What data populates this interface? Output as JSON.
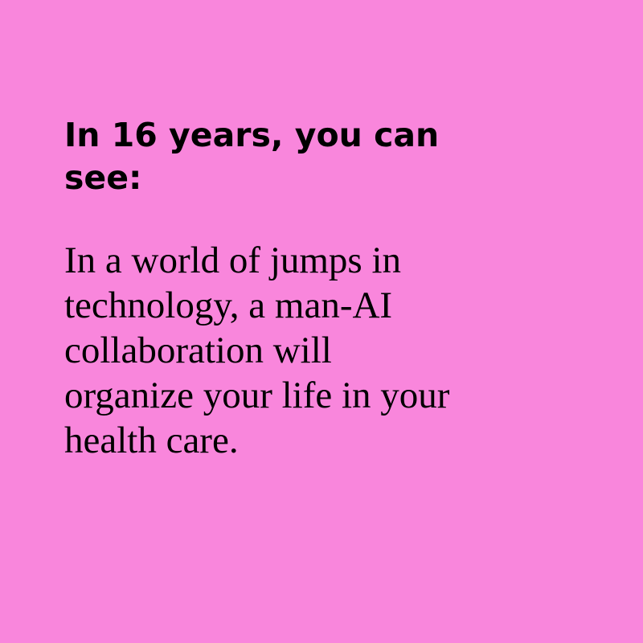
{
  "colors": {
    "background": "#f986dc",
    "text": "#000000"
  },
  "heading": {
    "lines": [
      "In 16 years, you can",
      "see:"
    ]
  },
  "body": {
    "lines": [
      "In a world of jumps in",
      "technology, a man-AI",
      "collaboration will",
      "organize your life in your",
      "health care."
    ]
  }
}
